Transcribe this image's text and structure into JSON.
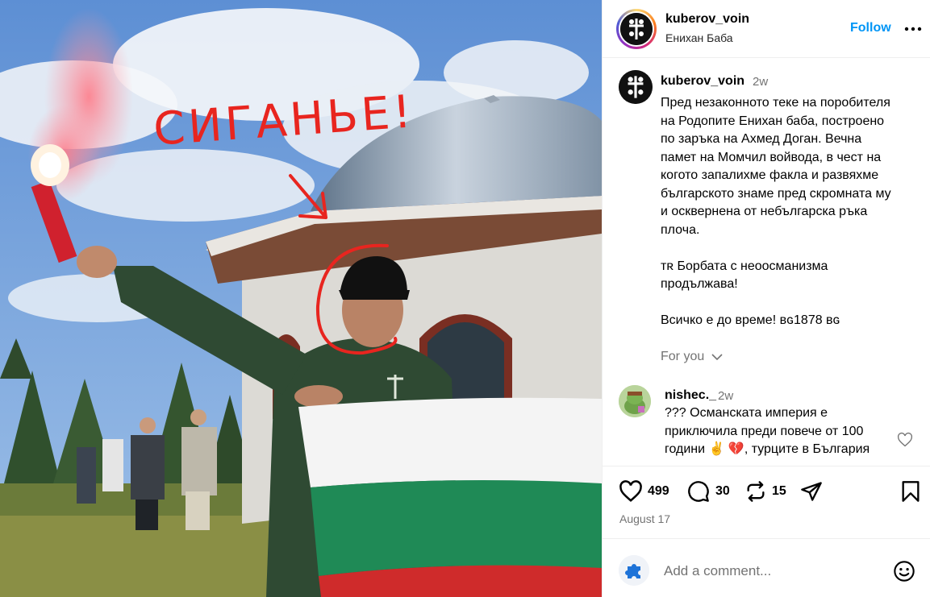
{
  "photo": {
    "overlay_text": "СИГАНЬЕ!"
  },
  "header": {
    "username": "kuberov_voin",
    "location": "Енихан Баба",
    "follow_label": "Follow"
  },
  "post": {
    "username": "kuberov_voin",
    "time": "2w",
    "caption_para1": "Пред незаконното теке на поробителя\nна Родопите Енихан баба, построено\nпо заръка на Ахмед Доган. Вечна\nпамет на Момчил войвода, в чест на\nкогото запалихме факла и развяхме\nбългарското знаме пред скромната му\nи осквернена от небългарска ръка\nплоча.",
    "caption_para2": "ᴛʀ Борбата с неоосманизма\nпродължава!",
    "caption_para3": "Всичко е до време! ʙɢ1878 ʙɢ",
    "for_you_label": "For you"
  },
  "comment": {
    "username": "nishec._",
    "time": "2w",
    "text": "??? Османската империя е\nприключила преди повече от 100\nгодини ✌️ 💔, турците в България"
  },
  "actions": {
    "likes": "499",
    "comments": "30",
    "reposts": "15",
    "date": "August 17"
  },
  "add_comment": {
    "placeholder": "Add a comment..."
  },
  "icons": {
    "like": "heart-icon",
    "comment": "comment-icon",
    "repost": "repost-icon",
    "share": "share-icon",
    "save": "bookmark-icon",
    "more": "more-dots-icon",
    "emoji": "emoji-icon"
  },
  "colors": {
    "follow": "#0095f6",
    "secondary_text": "#737373",
    "annotation_red": "#e8251f"
  }
}
